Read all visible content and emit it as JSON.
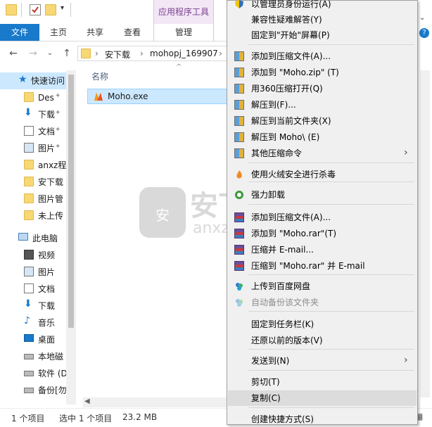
{
  "ribbon": {
    "contextual_tab": "应用程序工具",
    "tabs": [
      "文件",
      "主页",
      "共享",
      "查看",
      "管理"
    ],
    "help_icon": "?"
  },
  "address": {
    "path": [
      "安下载",
      "mohopj_169907"
    ],
    "separator": "›"
  },
  "nav": {
    "items": [
      {
        "label": "快速访问",
        "icon": "star-icon"
      },
      {
        "label": "Des",
        "icon": "folder-icon",
        "pinned": true
      },
      {
        "label": "下载",
        "icon": "download-icon",
        "pinned": true
      },
      {
        "label": "文档",
        "icon": "document-icon",
        "pinned": true
      },
      {
        "label": "图片",
        "icon": "picture-icon",
        "pinned": true
      },
      {
        "label": "anxz程",
        "icon": "folder-icon"
      },
      {
        "label": "安下载",
        "icon": "folder-icon"
      },
      {
        "label": "图片管",
        "icon": "folder-icon"
      },
      {
        "label": "未上传",
        "icon": "folder-icon"
      },
      {
        "label": "此电脑",
        "icon": "pc-icon"
      },
      {
        "label": "视频",
        "icon": "video-icon"
      },
      {
        "label": "图片",
        "icon": "picture-icon"
      },
      {
        "label": "文档",
        "icon": "document-icon"
      },
      {
        "label": "下载",
        "icon": "download-icon"
      },
      {
        "label": "音乐",
        "icon": "music-icon"
      },
      {
        "label": "桌面",
        "icon": "desktop-icon"
      },
      {
        "label": "本地磁",
        "icon": "drive-icon"
      },
      {
        "label": "软件 (D",
        "icon": "drive-icon"
      },
      {
        "label": "备份[勿",
        "icon": "drive-icon"
      }
    ]
  },
  "content": {
    "column_header": "名称",
    "file_name": "Moho.exe"
  },
  "watermark": {
    "text": "安下载",
    "sub": "anxz.com",
    "badge": "安"
  },
  "status": {
    "count": "1 个项目",
    "selected": "选中 1 个项目",
    "size": "23.2 MB"
  },
  "context_menu": {
    "items": [
      {
        "label": "以管理员身份运行(A)",
        "icon": "shield-icon"
      },
      {
        "label": "兼容性疑难解答(Y)",
        "icon": ""
      },
      {
        "label": "固定到\"开始\"屏幕(P)",
        "icon": ""
      },
      {
        "label": "添加到压缩文件(A)...",
        "icon": "winzip-icon"
      },
      {
        "label": "添加到 \"Moho.zip\" (T)",
        "icon": "winzip-icon"
      },
      {
        "label": "用360压缩打开(Q)",
        "icon": "winzip-icon"
      },
      {
        "label": "解压到(F)...",
        "icon": "winzip-icon"
      },
      {
        "label": "解压到当前文件夹(X)",
        "icon": "winzip-icon"
      },
      {
        "label": "解压到 Moho\\ (E)",
        "icon": "winzip-icon"
      },
      {
        "label": "其他压缩命令",
        "icon": "winzip-icon",
        "submenu": true
      },
      {
        "label": "使用火绒安全进行杀毒",
        "icon": "huorong-icon"
      },
      {
        "label": "强力卸载",
        "icon": "uninstall-icon"
      },
      {
        "label": "添加到压缩文件(A)...",
        "icon": "winrar-icon"
      },
      {
        "label": "添加到 \"Moho.rar\"(T)",
        "icon": "winrar-icon"
      },
      {
        "label": "压缩并 E-mail...",
        "icon": "winrar-icon"
      },
      {
        "label": "压缩到 \"Moho.rar\" 并 E-mail",
        "icon": "winrar-icon"
      },
      {
        "label": "上传到百度网盘",
        "icon": "baidu-icon"
      },
      {
        "label": "自动备份该文件夹",
        "icon": "baidu-icon",
        "disabled": true
      },
      {
        "label": "固定到任务栏(K)",
        "icon": ""
      },
      {
        "label": "还原以前的版本(V)",
        "icon": ""
      },
      {
        "label": "发送到(N)",
        "icon": "",
        "submenu": true
      },
      {
        "label": "剪切(T)",
        "icon": ""
      },
      {
        "label": "复制(C)",
        "icon": "",
        "highlighted": true
      },
      {
        "label": "创建快捷方式(S)",
        "icon": ""
      }
    ],
    "arrow": "›"
  },
  "colors": {
    "file_tab": "#1979ca",
    "selection": "#cce8ff",
    "contextual": "#f3e7f6"
  }
}
